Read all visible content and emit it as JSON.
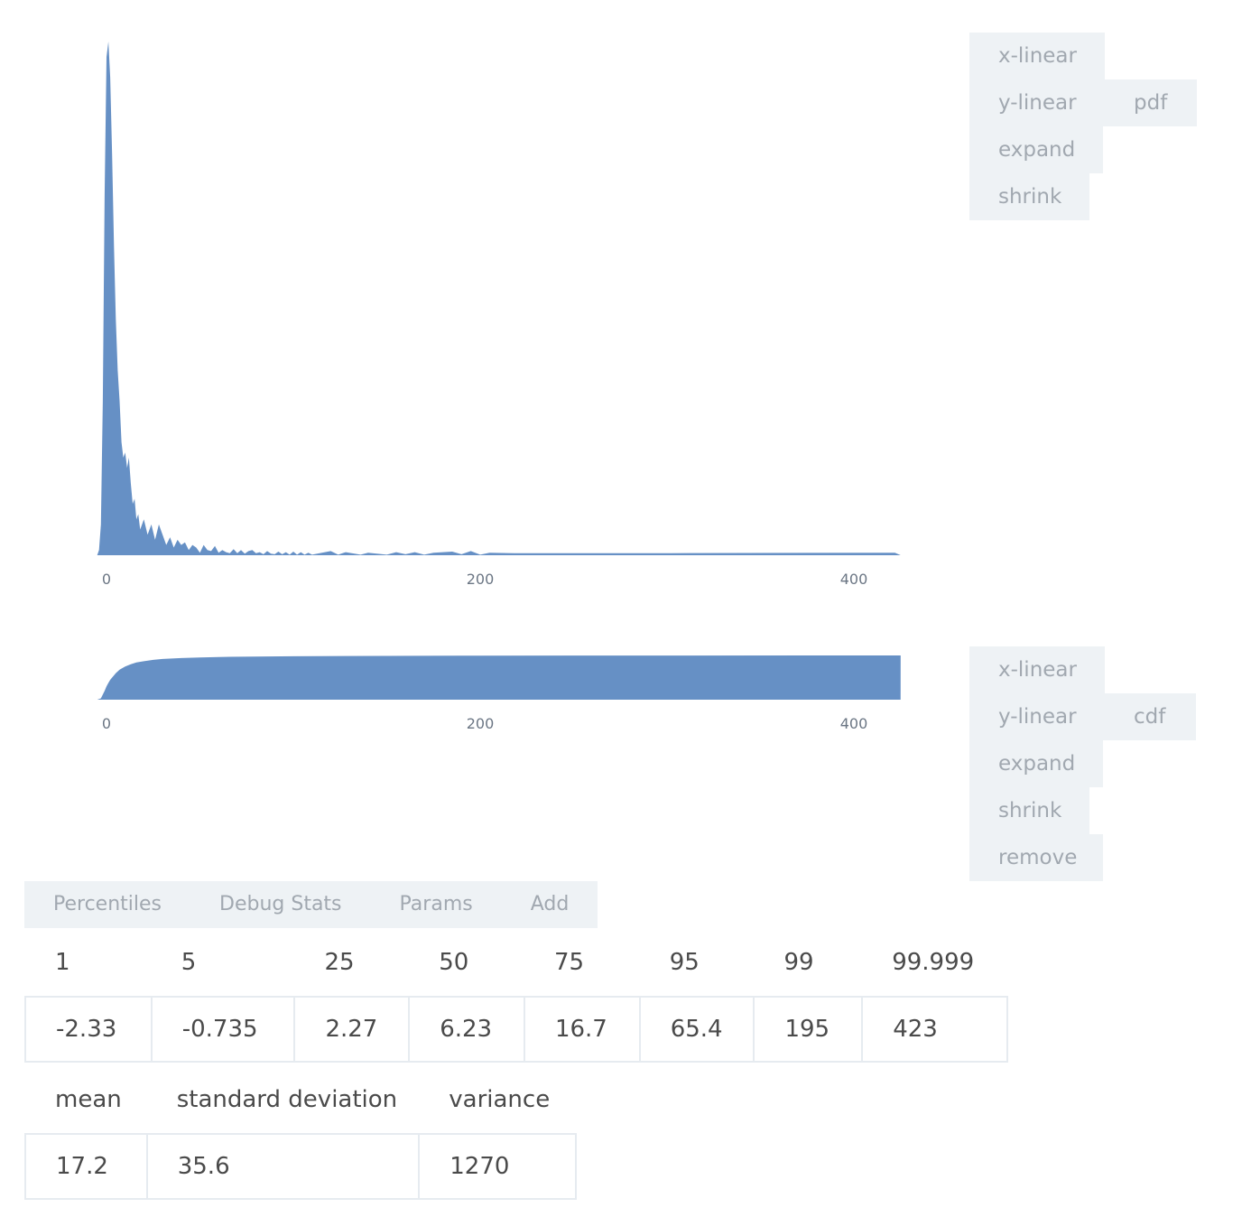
{
  "pdf_panel": {
    "buttons": [
      "x-linear",
      "y-linear",
      "expand",
      "shrink"
    ],
    "mode_label": "pdf"
  },
  "cdf_panel": {
    "buttons": [
      "x-linear",
      "y-linear",
      "expand",
      "shrink",
      "remove"
    ],
    "mode_label": "cdf"
  },
  "tabs": [
    "Percentiles",
    "Debug Stats",
    "Params",
    "Add"
  ],
  "percentiles": {
    "headers": [
      "1",
      "5",
      "25",
      "50",
      "75",
      "95",
      "99",
      "99.999"
    ],
    "values": [
      "-2.33",
      "-0.735",
      "2.27",
      "6.23",
      "16.7",
      "65.4",
      "195",
      "423"
    ]
  },
  "stats": {
    "headers": [
      "mean",
      "standard deviation",
      "variance"
    ],
    "values": [
      "17.2",
      "35.6",
      "1270"
    ]
  },
  "colors": {
    "series": "#6690c5",
    "button_bg": "#eef2f5",
    "button_text": "#a1a8b0"
  },
  "chart_data": [
    {
      "type": "area",
      "title": "",
      "xlabel": "",
      "ylabel": "",
      "xlim": [
        -5,
        425
      ],
      "ylim": [
        0,
        1
      ],
      "x_ticks": [
        "0",
        "200",
        "400"
      ],
      "x_tick_values": [
        0,
        200,
        400
      ],
      "grid": false,
      "x": [
        -5,
        -4,
        -3,
        -2,
        -1,
        0,
        1,
        2,
        3,
        4,
        5,
        6,
        7,
        8,
        9,
        10,
        11,
        12,
        13,
        14,
        15,
        16,
        17,
        18,
        20,
        22,
        24,
        26,
        28,
        30,
        32,
        34,
        36,
        38,
        40,
        42,
        44,
        46,
        48,
        50,
        52,
        54,
        56,
        58,
        60,
        62,
        64,
        66,
        68,
        70,
        72,
        74,
        76,
        78,
        80,
        82,
        84,
        86,
        88,
        90,
        92,
        94,
        96,
        98,
        100,
        102,
        104,
        106,
        108,
        110,
        120,
        124,
        128,
        136,
        140,
        150,
        155,
        160,
        165,
        170,
        175,
        185,
        190,
        195,
        200,
        205,
        218,
        230,
        262,
        274,
        295,
        302,
        422,
        425
      ],
      "y": [
        0,
        0.01,
        0.06,
        0.3,
        0.7,
        0.97,
        1.0,
        0.93,
        0.78,
        0.6,
        0.46,
        0.36,
        0.3,
        0.22,
        0.19,
        0.2,
        0.17,
        0.19,
        0.14,
        0.1,
        0.11,
        0.07,
        0.08,
        0.05,
        0.07,
        0.04,
        0.06,
        0.03,
        0.06,
        0.04,
        0.02,
        0.035,
        0.015,
        0.03,
        0.02,
        0.025,
        0.01,
        0.02,
        0.015,
        0.005,
        0.02,
        0.01,
        0.008,
        0.018,
        0.005,
        0.01,
        0.006,
        0.004,
        0.012,
        0.004,
        0.01,
        0.003,
        0.008,
        0.01,
        0.004,
        0.006,
        0.002,
        0.008,
        0.003,
        0.002,
        0.007,
        0.002,
        0.006,
        0.001,
        0.007,
        0.001,
        0.006,
        0.001,
        0.005,
        0.001,
        0.008,
        0.001,
        0.006,
        0.001,
        0.005,
        0.001,
        0.006,
        0.002,
        0.006,
        0.001,
        0.005,
        0.007,
        0.002,
        0.008,
        0.001,
        0.005,
        0.004,
        0.004,
        0.004,
        0.004,
        0.004,
        0.004,
        0.005,
        0
      ]
    },
    {
      "type": "area",
      "title": "",
      "xlabel": "",
      "ylabel": "",
      "xlim": [
        -5,
        425
      ],
      "ylim": [
        0,
        1
      ],
      "x_ticks": [
        "0",
        "200",
        "400"
      ],
      "x_tick_values": [
        0,
        200,
        400
      ],
      "grid": false,
      "x": [
        -5,
        -3,
        -1,
        0,
        1,
        2,
        3,
        5,
        7,
        10,
        13,
        16,
        20,
        25,
        30,
        40,
        50,
        60,
        80,
        100,
        150,
        200,
        300,
        425
      ],
      "y": [
        0,
        0.03,
        0.2,
        0.3,
        0.38,
        0.45,
        0.5,
        0.6,
        0.68,
        0.75,
        0.8,
        0.84,
        0.87,
        0.9,
        0.92,
        0.94,
        0.955,
        0.965,
        0.975,
        0.982,
        0.99,
        0.995,
        0.998,
        1.0
      ]
    }
  ]
}
